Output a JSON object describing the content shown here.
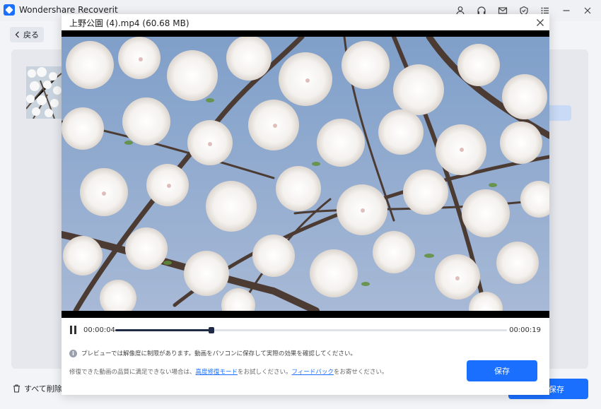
{
  "app": {
    "title": "Wondershare Recoverit",
    "accent": "#1a6fff"
  },
  "titlebar": {
    "icons": [
      "user-icon",
      "headset-icon",
      "mail-icon",
      "shield-icon",
      "menu-icon",
      "minimize-icon",
      "close-icon"
    ]
  },
  "toolbar": {
    "back_label": "戻る"
  },
  "footer": {
    "delete_all_label": "すべて削除",
    "save_label": "保存"
  },
  "dialog": {
    "title": "上野公園 (4).mp4 (60.68  MB)",
    "player": {
      "current_time": "00:00:04",
      "total_time": "00:00:19",
      "progress": 0.246
    },
    "info_text": "プレビューでは解像度に制限があります。動画をパソコンに保存して実際の効果を確認してください。",
    "help": {
      "prefix": "修復できた動画の品質に満足できない場合は、",
      "advanced_link": "高度修復モード",
      "middle": "をお試しください。",
      "feedback_link": "フィードバック",
      "suffix": "をお寄せください。"
    },
    "save_label": "保存"
  }
}
